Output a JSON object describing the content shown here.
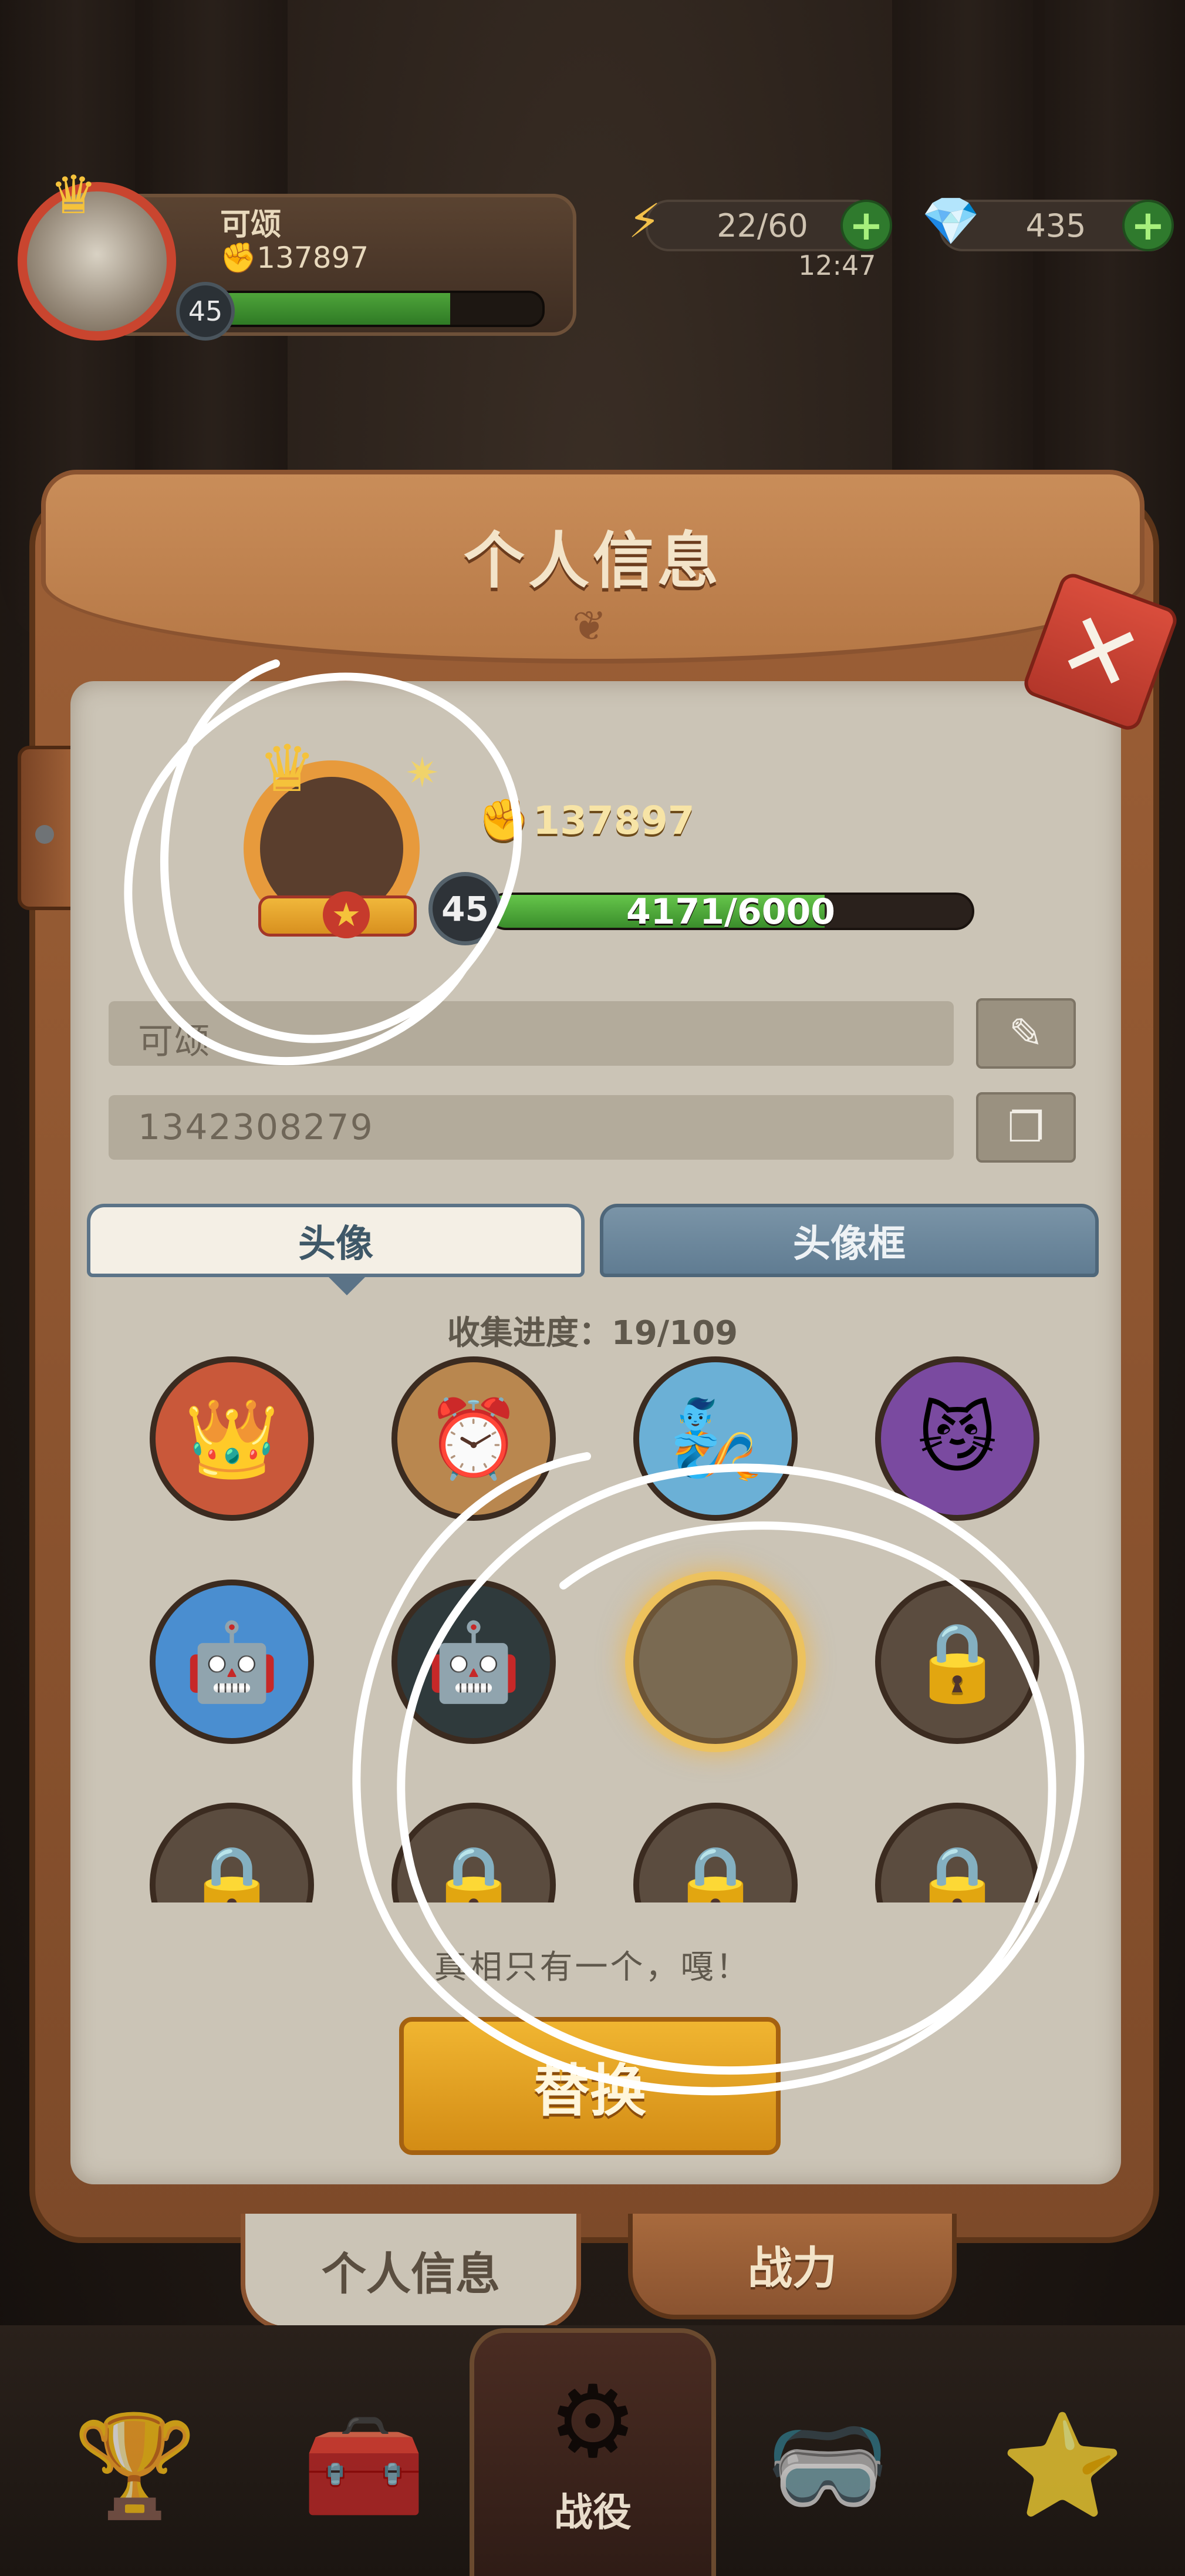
{
  "hud": {
    "player_name": "可颂",
    "power": "137897",
    "level": "45",
    "exp_fraction": 0.72,
    "energy": "22/60",
    "gems": "435",
    "timer": "12:47"
  },
  "panel": {
    "title": "个人信息",
    "close_icon": "close-icon",
    "profile": {
      "power": "137897",
      "level": "45",
      "exp": "4171/6000",
      "exp_fraction": 0.695
    },
    "name_value": "可颂",
    "id_value": "1342308279",
    "tabs": {
      "avatar": "头像",
      "frame": "头像框"
    },
    "progress": "收集进度：19/109",
    "grid": [
      {
        "name": "avatar-king-angry",
        "icon": "👑",
        "locked": false
      },
      {
        "name": "avatar-clock-butler",
        "icon": "⏰",
        "locked": false
      },
      {
        "name": "avatar-blue-genie",
        "icon": "🧞",
        "locked": false
      },
      {
        "name": "avatar-purple-cat",
        "icon": "😼",
        "locked": false
      },
      {
        "name": "avatar-blue-robot",
        "icon": "🤖",
        "locked": false
      },
      {
        "name": "avatar-green-robot",
        "icon": "🤖",
        "locked": false
      },
      {
        "name": "avatar-selected-empty",
        "icon": "",
        "locked": false,
        "selected": true
      },
      {
        "name": "avatar-locked",
        "icon": "🔒",
        "locked": true
      },
      {
        "name": "avatar-locked",
        "icon": "🔒",
        "locked": true
      },
      {
        "name": "avatar-locked",
        "icon": "🔒",
        "locked": true
      },
      {
        "name": "avatar-locked",
        "icon": "🔒",
        "locked": true
      },
      {
        "name": "avatar-locked",
        "icon": "🔒",
        "locked": true
      }
    ],
    "message": "真相只有一个，嘎！",
    "replace_label": "替换",
    "bottom_tabs": {
      "info": "个人信息",
      "power": "战力"
    }
  },
  "nav": {
    "battle": "战役"
  }
}
